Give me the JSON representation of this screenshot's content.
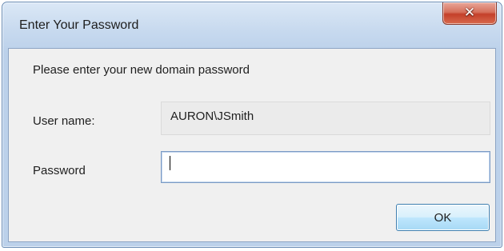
{
  "window": {
    "title": "Enter Your Password"
  },
  "dialog": {
    "prompt": "Please enter your new domain password",
    "user_name_label": "User name:",
    "user_name_value": "AURON\\JSmith",
    "password_label": "Password",
    "password_value": "",
    "ok_label": "OK"
  },
  "icons": {
    "close": "close-icon"
  },
  "colors": {
    "title_bar": "#c8daef",
    "close_button": "#c4402a",
    "client_background": "#f0f0f0",
    "ok_button": "#bee6fd"
  }
}
